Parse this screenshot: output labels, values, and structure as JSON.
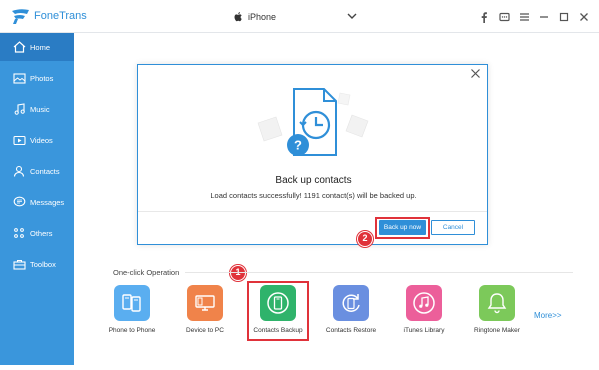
{
  "app": {
    "name": "FoneTrans"
  },
  "device": {
    "name": "iPhone"
  },
  "titlebar_icons": [
    "facebook-icon",
    "chat-icon",
    "menu-icon",
    "minimize-icon",
    "maximize-icon",
    "close-icon"
  ],
  "sidebar": {
    "items": [
      {
        "label": "Home",
        "icon": "home-icon",
        "active": true
      },
      {
        "label": "Photos",
        "icon": "photos-icon"
      },
      {
        "label": "Music",
        "icon": "music-icon"
      },
      {
        "label": "Videos",
        "icon": "videos-icon"
      },
      {
        "label": "Contacts",
        "icon": "contacts-icon"
      },
      {
        "label": "Messages",
        "icon": "messages-icon"
      },
      {
        "label": "Others",
        "icon": "others-icon"
      },
      {
        "label": "Toolbox",
        "icon": "toolbox-icon"
      }
    ]
  },
  "dialog": {
    "title": "Back up contacts",
    "message": "Load contacts successfully! 1191 contact(s) will be backed up.",
    "primary_button": "Back up now",
    "cancel_button": "Cancel"
  },
  "annotations": {
    "step1": "1",
    "step2": "2"
  },
  "one_click": {
    "label": "One-click Operation",
    "tools": [
      {
        "label": "Phone to Phone",
        "color": "#5aaef0"
      },
      {
        "label": "Device to PC",
        "color": "#f0834a"
      },
      {
        "label": "Contacts Backup",
        "color": "#2fb36b"
      },
      {
        "label": "Contacts Restore",
        "color": "#6a8fe0"
      },
      {
        "label": "iTunes Library",
        "color": "#ec5f9a"
      },
      {
        "label": "Ringtone Maker",
        "color": "#7cc95a"
      }
    ],
    "more": "More>>"
  },
  "colors": {
    "accent": "#2f8fd8",
    "sidebar": "#3a96dc",
    "sidebar_active": "#2a7cc4",
    "annotation": "#e0323a"
  }
}
